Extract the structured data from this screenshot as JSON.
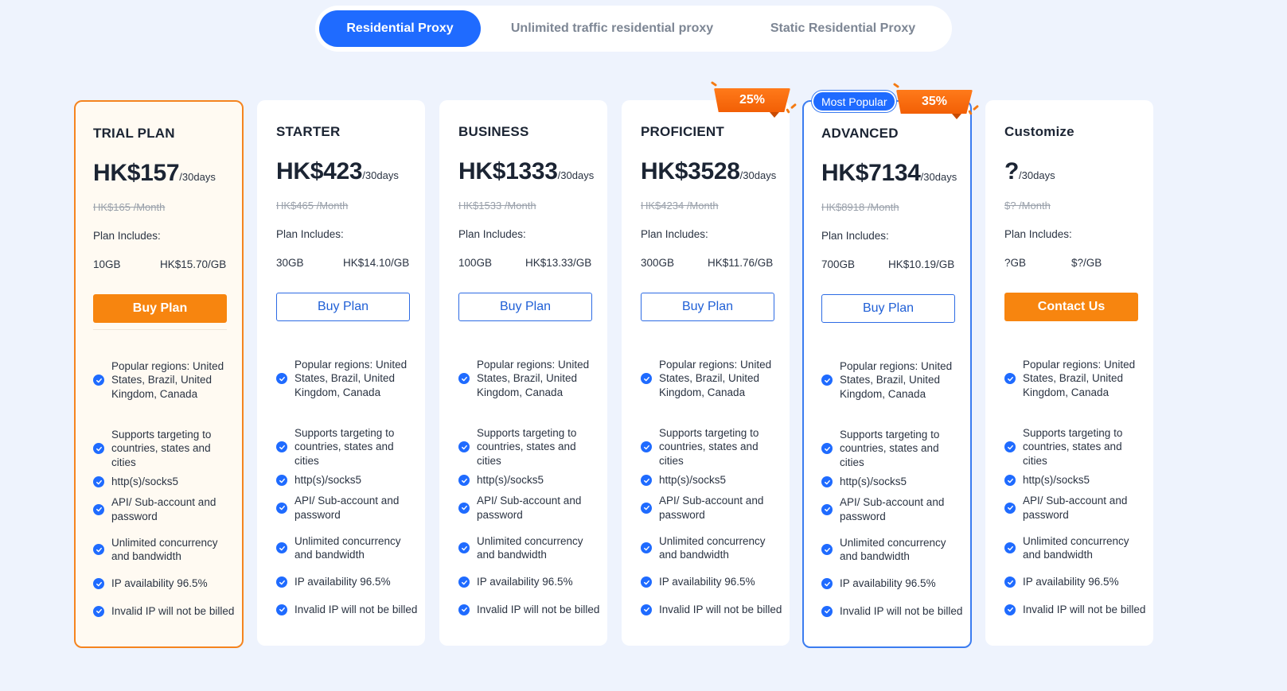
{
  "tabs": [
    {
      "label": "Residential Proxy",
      "active": true
    },
    {
      "label": "Unlimited traffic residential proxy",
      "active": false
    },
    {
      "label": "Static Residential Proxy",
      "active": false
    }
  ],
  "labels": {
    "plan_includes": "Plan Includes:",
    "most_popular": "Most Popular"
  },
  "colors": {
    "accent_blue": "#1f6bff",
    "accent_orange": "#f7850f",
    "page_bg": "#eef3fd"
  },
  "features": [
    "Popular regions: United States, Brazil, United Kingdom, Canada",
    "Supports targeting to countries, states and cities",
    "http(s)/socks5",
    "API/ Sub-account and password",
    "Unlimited concurrency and bandwidth",
    "IP availability 96.5%",
    "Invalid IP will not be billed"
  ],
  "plans": [
    {
      "name": "TRIAL PLAN",
      "price": "HK$157",
      "period": "/30days",
      "old_price": "HK$165 /Month",
      "gb": "10GB",
      "per_gb": "HK$15.70/GB",
      "button": "Buy Plan"
    },
    {
      "name": "STARTER",
      "price": "HK$423",
      "period": "/30days",
      "old_price": "HK$465 /Month",
      "gb": "30GB",
      "per_gb": "HK$14.10/GB",
      "button": "Buy Plan"
    },
    {
      "name": "BUSINESS",
      "price": "HK$1333",
      "period": "/30days",
      "old_price": "HK$1533 /Month",
      "gb": "100GB",
      "per_gb": "HK$13.33/GB",
      "button": "Buy Plan"
    },
    {
      "name": "PROFICIENT",
      "price": "HK$3528",
      "period": "/30days",
      "old_price": "HK$4234 /Month",
      "gb": "300GB",
      "per_gb": "HK$11.76/GB",
      "button": "Buy Plan",
      "discount": "25%"
    },
    {
      "name": "ADVANCED",
      "price": "HK$7134",
      "period": "/30days",
      "old_price": "HK$8918 /Month",
      "gb": "700GB",
      "per_gb": "HK$10.19/GB",
      "button": "Buy Plan",
      "discount": "35%"
    },
    {
      "name": "Customize",
      "price": "?",
      "period": "/30days",
      "old_price": "$? /Month",
      "gb": "?GB",
      "per_gb": "$?/GB",
      "button": "Contact Us"
    }
  ]
}
